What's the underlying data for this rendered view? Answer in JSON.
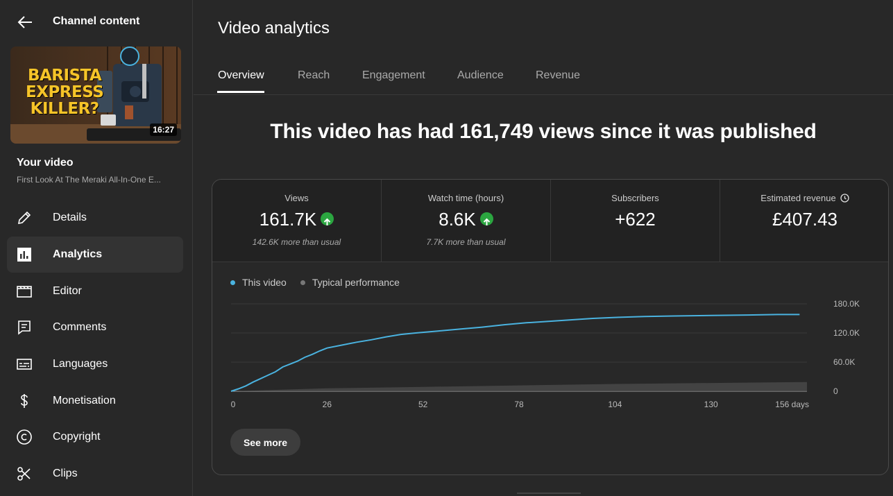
{
  "sidebar": {
    "header_title": "Channel content",
    "thumbnail": {
      "text_lines": [
        "BARISTA",
        "EXPRESS",
        "KILLER?"
      ],
      "duration": "16:27"
    },
    "your_video_label": "Your video",
    "video_title": "First Look At The Meraki All-In-One E...",
    "items": [
      {
        "label": "Details",
        "icon": "pencil-icon"
      },
      {
        "label": "Analytics",
        "icon": "analytics-icon",
        "active": true
      },
      {
        "label": "Editor",
        "icon": "clapperboard-icon"
      },
      {
        "label": "Comments",
        "icon": "comment-icon"
      },
      {
        "label": "Languages",
        "icon": "subtitles-icon"
      },
      {
        "label": "Monetisation",
        "icon": "dollar-icon"
      },
      {
        "label": "Copyright",
        "icon": "copyright-icon"
      },
      {
        "label": "Clips",
        "icon": "scissors-icon"
      }
    ]
  },
  "main": {
    "title": "Video analytics",
    "tabs": [
      {
        "label": "Overview",
        "active": true
      },
      {
        "label": "Reach"
      },
      {
        "label": "Engagement"
      },
      {
        "label": "Audience"
      },
      {
        "label": "Revenue"
      }
    ],
    "headline": "This video has had 161,749 views since it was published",
    "metrics": [
      {
        "label": "Views",
        "value": "161.7K",
        "note": "142.6K more than usual",
        "trend": "up"
      },
      {
        "label": "Watch time (hours)",
        "value": "8.6K",
        "note": "7.7K more than usual",
        "trend": "up"
      },
      {
        "label": "Subscribers",
        "value": "+622",
        "note": ""
      },
      {
        "label": "Estimated revenue",
        "value": "£407.43",
        "note": "",
        "icon": "clock-icon"
      }
    ],
    "see_more_label": "See more"
  },
  "colors": {
    "accent_series": "#4ab3e0",
    "typical_series": "#5a5a5a",
    "trend_up": "#2ba640",
    "background": "#282828"
  },
  "chart_data": {
    "type": "line",
    "x_ticks": [
      "0",
      "26",
      "52",
      "78",
      "104",
      "130",
      "156 days"
    ],
    "y_ticks": [
      "180.0K",
      "120.0K",
      "60.0K",
      "0"
    ],
    "xlim": [
      0,
      156
    ],
    "ylim": [
      0,
      180000
    ],
    "grid": true,
    "legend_position": "top-left",
    "series": [
      {
        "name": "This video",
        "x": [
          0,
          2,
          4,
          6,
          8,
          10,
          12,
          14,
          16,
          18,
          20,
          22,
          24,
          26,
          30,
          34,
          38,
          42,
          46,
          50,
          56,
          62,
          68,
          74,
          80,
          86,
          92,
          98,
          104,
          112,
          120,
          130,
          140,
          148,
          154
        ],
        "values": [
          0,
          5000,
          11000,
          19000,
          26000,
          33000,
          40000,
          50000,
          56000,
          62000,
          70000,
          76000,
          83000,
          89000,
          95000,
          101000,
          106000,
          112000,
          117000,
          120000,
          124000,
          128000,
          132000,
          137000,
          141000,
          144000,
          147000,
          150000,
          152000,
          154000,
          155000,
          156000,
          157000,
          158000,
          158000
        ]
      },
      {
        "name": "Typical performance",
        "x": [
          0,
          26,
          52,
          78,
          104,
          130,
          156
        ],
        "values": [
          0,
          6000,
          9000,
          12000,
          15000,
          17000,
          19000
        ]
      }
    ]
  }
}
